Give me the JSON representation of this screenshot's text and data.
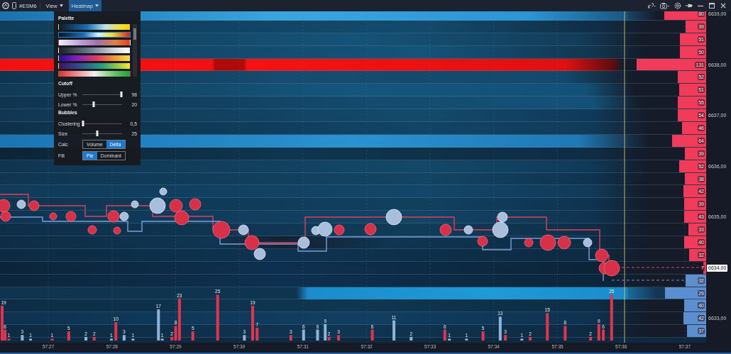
{
  "toolbar": {
    "symbol": "#ESM6",
    "menus": [
      {
        "label": "View",
        "selected": false
      },
      {
        "label": "Heatmap",
        "selected": true
      }
    ]
  },
  "heatmap_menu": {
    "palette_title": "Palette",
    "palettes": [
      {
        "selected": false
      },
      {
        "selected": true
      },
      {
        "selected": false
      },
      {
        "selected": false
      },
      {
        "selected": false
      },
      {
        "selected": false
      },
      {
        "selected": false
      }
    ],
    "cutoff_title": "Cutoff",
    "cutoff": [
      {
        "label": "Upper %",
        "level": 0.98,
        "reading": "98"
      },
      {
        "label": "Lower %",
        "level": 0.28,
        "reading": "20"
      }
    ],
    "bubbles_title": "Bubbles",
    "bubbles": [
      {
        "label": "Clustering",
        "level": 0.02,
        "reading": "0,5"
      },
      {
        "label": "Size",
        "level": 0.38,
        "reading": "25"
      }
    ],
    "toggles": [
      {
        "label": "Calc",
        "options": [
          {
            "label": "Volume",
            "selected": false
          },
          {
            "label": "Delta",
            "selected": true
          }
        ]
      },
      {
        "label": "Fill",
        "options": [
          {
            "label": "Pie",
            "selected": true
          },
          {
            "label": "Dominant",
            "selected": false
          }
        ]
      }
    ]
  },
  "ladder": [
    {
      "volume": "80",
      "color": "#f23b5a",
      "level": 0.54,
      "price": "6639,00",
      "current": false
    },
    {
      "volume": "39",
      "color": "#f23b5a",
      "level": 0.26
    },
    {
      "volume": "51",
      "color": "#f23b5a",
      "level": 0.34
    },
    {
      "volume": "50",
      "color": "#f23b5a",
      "level": 0.34
    },
    {
      "volume": "131",
      "color": "#f23b5a",
      "level": 0.89,
      "price": "6638,00",
      "current": false
    },
    {
      "volume": "52",
      "color": "#f23b5a",
      "level": 0.36
    },
    {
      "volume": "51",
      "color": "#f23b5a",
      "level": 0.35
    },
    {
      "volume": "55",
      "color": "#f23b5a",
      "level": 0.36
    },
    {
      "volume": "54",
      "color": "#f23b5a",
      "level": 0.36,
      "price": "6637,00",
      "current": false
    },
    {
      "volume": "46",
      "color": "#f23b5a",
      "level": 0.31
    },
    {
      "volume": "64",
      "color": "#f23b5a",
      "level": 0.44
    },
    {
      "volume": "39",
      "color": "#f23b5a",
      "level": 0.27
    },
    {
      "volume": "52",
      "color": "#f23b5a",
      "level": 0.35,
      "price": "6636,00",
      "current": false
    },
    {
      "volume": "38",
      "color": "#f23b5a",
      "level": 0.27
    },
    {
      "volume": "42",
      "color": "#f23b5a",
      "level": 0.29
    },
    {
      "volume": "39",
      "color": "#f23b5a",
      "level": 0.28
    },
    {
      "volume": "43",
      "color": "#f23b5a",
      "level": 0.28,
      "price": "6635,00",
      "current": false
    },
    {
      "volume": "33",
      "color": "#f23b5a",
      "level": 0.23
    },
    {
      "volume": "40",
      "color": "#f23b5a",
      "level": 0.28
    },
    {
      "volume": "32",
      "color": "#f23b5a",
      "level": 0.22
    },
    {
      "volume": "7",
      "color": "#f23b5a",
      "level": 0.04,
      "price": "6634,00",
      "current": true
    },
    {
      "volume": "32",
      "color": "#5b8fd0",
      "level": 0.26
    },
    {
      "volume": "29",
      "color": "#5b8fd0",
      "level": 0.53
    },
    {
      "volume": "40",
      "color": "#5b8fd0",
      "level": 0.28
    },
    {
      "volume": "42",
      "color": "#5b8fd0",
      "level": 0.29,
      "price": "6633,00",
      "current": false
    },
    {
      "volume": "37",
      "color": "#5b8fd0",
      "level": 0.25
    }
  ],
  "volume_chart": {
    "chart_data": {
      "type": "bar",
      "data_labels": true,
      "x": [
        3446.26,
        3446.32,
        3446.38,
        3446.59,
        3446.72,
        3447.06,
        3447.32,
        3447.59,
        3447.72,
        3447.99,
        3448.06,
        3448.19,
        3448.33,
        3448.73,
        3448.79,
        3448.94,
        3449.0,
        3449.06,
        3449.27,
        3449.66,
        3450.08,
        3450.21,
        3450.28,
        3450.81,
        3451.01,
        3451.23,
        3451.35,
        3451.41,
        3451.56,
        3452.09,
        3452.43,
        3452.7,
        3453.23,
        3453.3,
        3453.57,
        3453.83,
        3454.1,
        3454.18,
        3454.44,
        3454.57,
        3454.84,
        3455.12,
        3455.52,
        3455.65,
        3455.72,
        3455.85
      ],
      "series": [
        {
          "color": "#e0344f",
          "values": [
            19,
            6,
            1,
            null,
            null,
            1,
            5,
            null,
            2,
            null,
            10,
            null,
            null,
            null,
            null,
            2,
            8,
            23,
            5,
            25,
            null,
            19,
            7,
            3,
            null,
            null,
            null,
            2,
            3,
            6,
            null,
            null,
            6,
            null,
            null,
            5,
            null,
            3,
            null,
            2,
            15,
            8,
            2,
            9,
            6,
            25
          ]
        },
        {
          "color": "#8fb3d9",
          "values": [
            null,
            null,
            null,
            3,
            1,
            null,
            null,
            2,
            null,
            1,
            null,
            3,
            1,
            17,
            1,
            null,
            null,
            null,
            null,
            null,
            3,
            null,
            null,
            null,
            6,
            6,
            9,
            null,
            null,
            null,
            11,
            2,
            null,
            1,
            1,
            null,
            13,
            null,
            1,
            null,
            null,
            null,
            null,
            null,
            null,
            null
          ]
        }
      ],
      "xlim": [
        3446.24,
        3457.28
      ],
      "xticks": [
        {
          "value": 3447,
          "label": "57:27"
        },
        {
          "value": 3448,
          "label": "57:28"
        },
        {
          "value": 3449,
          "label": "57:29"
        },
        {
          "value": 3450,
          "label": "57:30"
        },
        {
          "value": 3451,
          "label": "57:31"
        },
        {
          "value": 3452,
          "label": "57:32"
        },
        {
          "value": 3453,
          "label": "57:33"
        },
        {
          "value": 3454,
          "label": "57:34"
        },
        {
          "value": 3455,
          "label": "57:35"
        },
        {
          "value": 3456,
          "label": "57:36"
        },
        {
          "value": 3457,
          "label": "57:37"
        }
      ]
    }
  }
}
